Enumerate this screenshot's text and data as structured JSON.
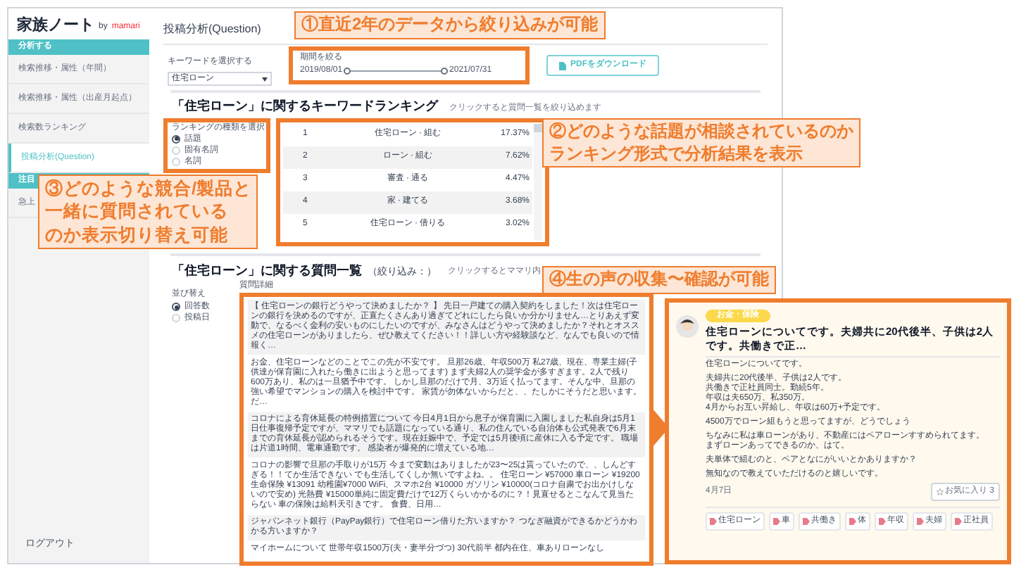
{
  "sidebar": {
    "logo": "家族ノート",
    "logo_by": "by",
    "logo_brand": "mamari",
    "sections": [
      {
        "title": "分析する",
        "items": [
          {
            "label": "検索推移・属性（年間）",
            "selected": false
          },
          {
            "label": "検索推移・属性（出産月起点）",
            "selected": false
          },
          {
            "label": "検索数ランキング",
            "selected": false
          },
          {
            "label": "投稿分析(Question)",
            "selected": true
          }
        ]
      },
      {
        "title": "注目",
        "items": [
          {
            "label": "急上",
            "selected": false
          }
        ]
      }
    ],
    "logout": "ログアウト"
  },
  "page_title": "投稿分析(Question)",
  "keyword_select": {
    "label": "キーワードを選択する",
    "value": "住宅ローン"
  },
  "period": {
    "label": "期間を絞る",
    "start": "2019/08/01",
    "end": "2021/07/31",
    "thumbs": [
      {
        "level": 0
      },
      {
        "level": 1
      }
    ]
  },
  "pdf_button": "PDFをダウンロード",
  "ranking": {
    "title": "「住宅ローン」に関するキーワードランキング",
    "hint": "クリックすると質問一覧を絞り込めます",
    "type_label": "ランキングの種類を選択",
    "types": [
      {
        "label": "話題",
        "selected": true
      },
      {
        "label": "固有名詞",
        "selected": false
      },
      {
        "label": "名詞",
        "selected": false
      }
    ],
    "rows": [
      {
        "rank": "1",
        "keyword": "住宅ローン · 組む",
        "share": "17.37%"
      },
      {
        "rank": "2",
        "keyword": "ローン · 組む",
        "share": "7.62%"
      },
      {
        "rank": "3",
        "keyword": "審査 · 通る",
        "share": "4.47%"
      },
      {
        "rank": "4",
        "keyword": "家 · 建てる",
        "share": "3.68%"
      },
      {
        "rank": "5",
        "keyword": "住宅ローン · 借りる",
        "share": "3.02%"
      }
    ]
  },
  "questions": {
    "title": "「住宅ローン」に関する質問一覧",
    "filter": "（絞り込み：）",
    "hint": "クリックするとママリ内",
    "sort_label": "並び替え",
    "sorts": [
      {
        "label": "回答数",
        "selected": true
      },
      {
        "label": "投稿日",
        "selected": false
      }
    ],
    "column": "質問詳細",
    "rows": [
      {
        "text": "【 住宅ローンの銀行どうやって決めましたか？ 】 先日一戸建ての購入契約をしました！次は住宅ローンの銀行を決めるのですが、正直たくさんあり過ぎてどれにしたら良いか分かりません…とりあえず変動で、なるべく金利の安いものにしたいのですが、みなさんはどうやって決めましたか？それとオススメの住宅ローンがありましたら、ぜひ教えてください！！詳しい方や経験談など、なんでも良いので情報く…"
      },
      {
        "text": "お金、住宅ローンなどのことでこの先が不安です。 旦那26歳、年収500万 私27歳、現在、専業主婦(子供達が保育園に入れたら働きに出ようと思ってます) まず夫婦2人の奨学金が多すぎます。2人で残り600万あり、私のは一旦猶予中です。 しかし旦那のだけで月、3万近く払ってます。そんな中、旦那の強い希望でマンションの購入を検討中です。 家賃が勿体ないからだと、、たしかにそうだと思います。だ…"
      },
      {
        "text": "コロナによる育休延長の特例措置について 今日4月1日から息子が保育園に入園しました私自身は5月1日仕事復帰予定ですが、ママリでも話題になっている通り、私の住んでいる自治体も公式発表で6月末までの育休延長が認められるそうです。現在妊娠中で、予定では5月後頃に産休に入る予定です。 職場は片道1時間、電車通勤です。 感染者が爆発的に増えている地…"
      },
      {
        "text": "コロナの影響で旦那の手取りが15万 今まで変動はありましたが23〜25は貰っていたので、、しんどすぎる！！てか生活できない でも生活してくしか無いですよね。。 住宅ローン ¥57000 車ローン ¥19200 生命保険 ¥13091 幼稚園¥7000 WiFi、スマホ2台 ¥10000 ガソリン ¥10000(コロナ自粛でお出かけしないので安め) 光熱費 ¥15000単純に固定費だけで12万くらいかかるのに？！見直せるとこなんて見当たらない 車の保険は給料天引きです。 食費、日用…"
      },
      {
        "text": "ジャパンネット銀行（PayPay銀行）で住宅ローン借りた方いますか？ つなぎ融資ができるかどうかわかる方いますか？"
      },
      {
        "text": "マイホームについて 世帯年収1500万(夫・妻半分づつ) 30代前半 都内在住、車ありローンなし"
      }
    ]
  },
  "detail_card": {
    "category": "お金・保険",
    "title": "住宅ローンについてです。夫婦共に20代後半、子供は2人です。共働きで正…",
    "paragraphs": [
      [
        "住宅ローンについてです。"
      ],
      [
        "夫婦共に20代後半、子供は2人です。",
        "共働きで正社員同士。勤続5年。",
        "年収は夫650万、私350万。",
        "4月からお互い昇給し、年収は60万+予定です。"
      ],
      [
        "4500万でローン組もうと思ってますが、どうでしょう"
      ],
      [
        "ちなみに私は車ローンがあり、不動産にはペアローンすすめられてます。",
        "まずローンあってできるのか、はて。"
      ],
      [
        "夫単体で組むのと、ペアとなにがいいとかありますか？"
      ],
      [
        "無知なので教えていただけるのと嬉しいです。"
      ]
    ],
    "date": "4月7日",
    "favorite": "お気に入り 3",
    "tags": [
      "住宅ローン",
      "車",
      "共働き",
      "体",
      "年収",
      "夫婦",
      "正社員"
    ]
  },
  "callouts": [
    {
      "kind": "period",
      "lines": [
        "①直近2年のデータから絞り込みが可能"
      ]
    },
    {
      "kind": "ranking",
      "lines": [
        "②どのような話題が相談されているのか",
        "ランキング形式で分析結果を表示"
      ]
    },
    {
      "kind": "types",
      "lines": [
        "③どのような競合/製品と",
        "一緒に質問されている",
        "のか表示切り替え可能"
      ]
    },
    {
      "kind": "voices",
      "lines": [
        "④生の声の収集〜確認が可能"
      ]
    }
  ]
}
